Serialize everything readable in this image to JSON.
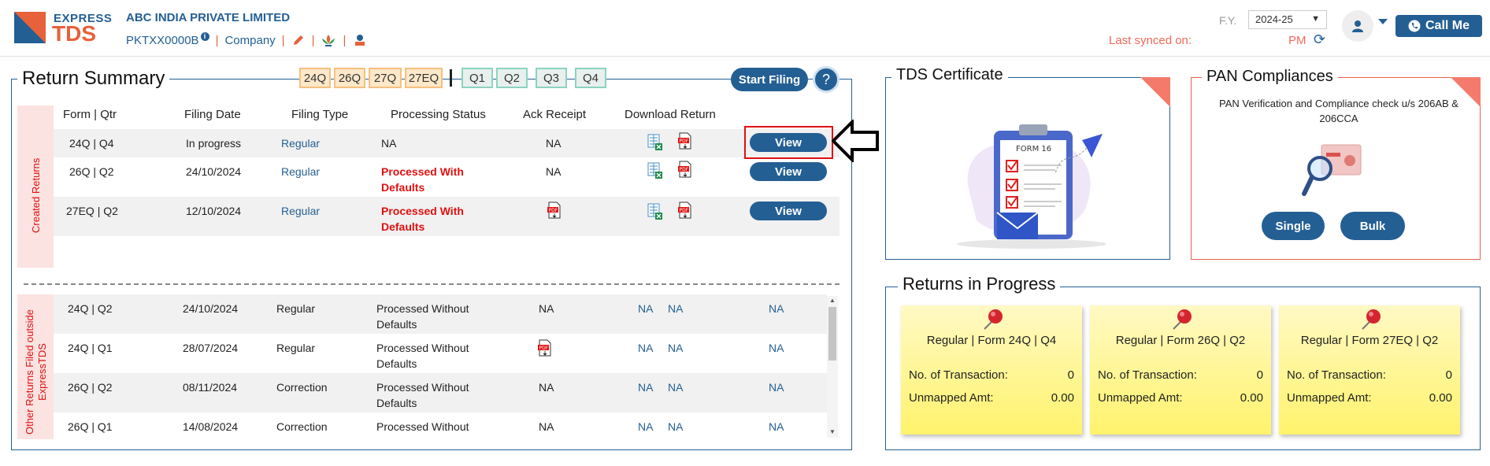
{
  "header": {
    "logo_express": "EXPRESS",
    "logo_tds": "TDS",
    "company_name": "ABC INDIA PRIVATE LIMITED",
    "pan": "PKTXX0000B",
    "entity_type": "Company",
    "fy_label": "F.Y.",
    "fy_value": "2024-25",
    "last_synced_label": "Last synced on:",
    "last_synced_time": "PM",
    "call_me": "Call Me"
  },
  "return_summary": {
    "title": "Return Summary",
    "form_chips": [
      "24Q",
      "26Q",
      "27Q",
      "27EQ"
    ],
    "quarter_chips": [
      "Q1",
      "Q2",
      "Q3",
      "Q4"
    ],
    "start_filing": "Start Filing",
    "help": "?",
    "columns": [
      "Form | Qtr",
      "Filing Date",
      "Filing Type",
      "Processing Status",
      "Ack Receipt",
      "Download Return"
    ],
    "created_label": "Created Returns",
    "created_rows": [
      {
        "form": "24Q | Q4",
        "date": "In progress",
        "type": "Regular",
        "status": "NA",
        "ack": "NA",
        "action": "View"
      },
      {
        "form": "26Q | Q2",
        "date": "24/10/2024",
        "type": "Regular",
        "status": "Processed With Defaults",
        "ack": "NA",
        "action": "View"
      },
      {
        "form": "27EQ | Q2",
        "date": "12/10/2024",
        "type": "Regular",
        "status": "Processed With Defaults",
        "ack": "",
        "action": "View"
      }
    ],
    "other_label_1": "Other Returns Filed outside",
    "other_label_2": "ExpressTDS",
    "other_rows": [
      {
        "form": "24Q | Q2",
        "date": "24/10/2024",
        "type": "Regular",
        "status": "Processed Without Defaults",
        "ack": "NA",
        "d1": "NA",
        "d2": "NA",
        "d3": "NA"
      },
      {
        "form": "24Q | Q1",
        "date": "28/07/2024",
        "type": "Regular",
        "status": "Processed Without Defaults",
        "ack": "",
        "d1": "NA",
        "d2": "NA",
        "d3": "NA"
      },
      {
        "form": "26Q | Q2",
        "date": "08/11/2024",
        "type": "Correction",
        "status": "Processed Without Defaults",
        "ack": "NA",
        "d1": "NA",
        "d2": "NA",
        "d3": "NA"
      },
      {
        "form": "26Q | Q1",
        "date": "14/08/2024",
        "type": "Correction",
        "status": "Processed Without",
        "ack": "NA",
        "d1": "NA",
        "d2": "NA",
        "d3": "NA"
      }
    ]
  },
  "tds_certificate": {
    "title": "TDS Certificate",
    "form_label": "FORM 16"
  },
  "pan_compliances": {
    "title": "PAN Compliances",
    "description": "PAN Verification and Compliance check u/s 206AB & 206CCA",
    "single": "Single",
    "bulk": "Bulk"
  },
  "returns_in_progress": {
    "title": "Returns in Progress",
    "txn_label": "No. of Transaction:",
    "unmapped_label": "Unmapped Amt:",
    "cards": [
      {
        "title": "Regular | Form 24Q | Q4",
        "transactions": "0",
        "unmapped": "0.00"
      },
      {
        "title": "Regular | Form 26Q | Q2",
        "transactions": "0",
        "unmapped": "0.00"
      },
      {
        "title": "Regular | Form 27EQ | Q2",
        "transactions": "0",
        "unmapped": "0.00"
      }
    ]
  },
  "colors": {
    "brand_blue": "#245f94",
    "brand_orange": "#e7613a",
    "status_red": "#e01010"
  }
}
